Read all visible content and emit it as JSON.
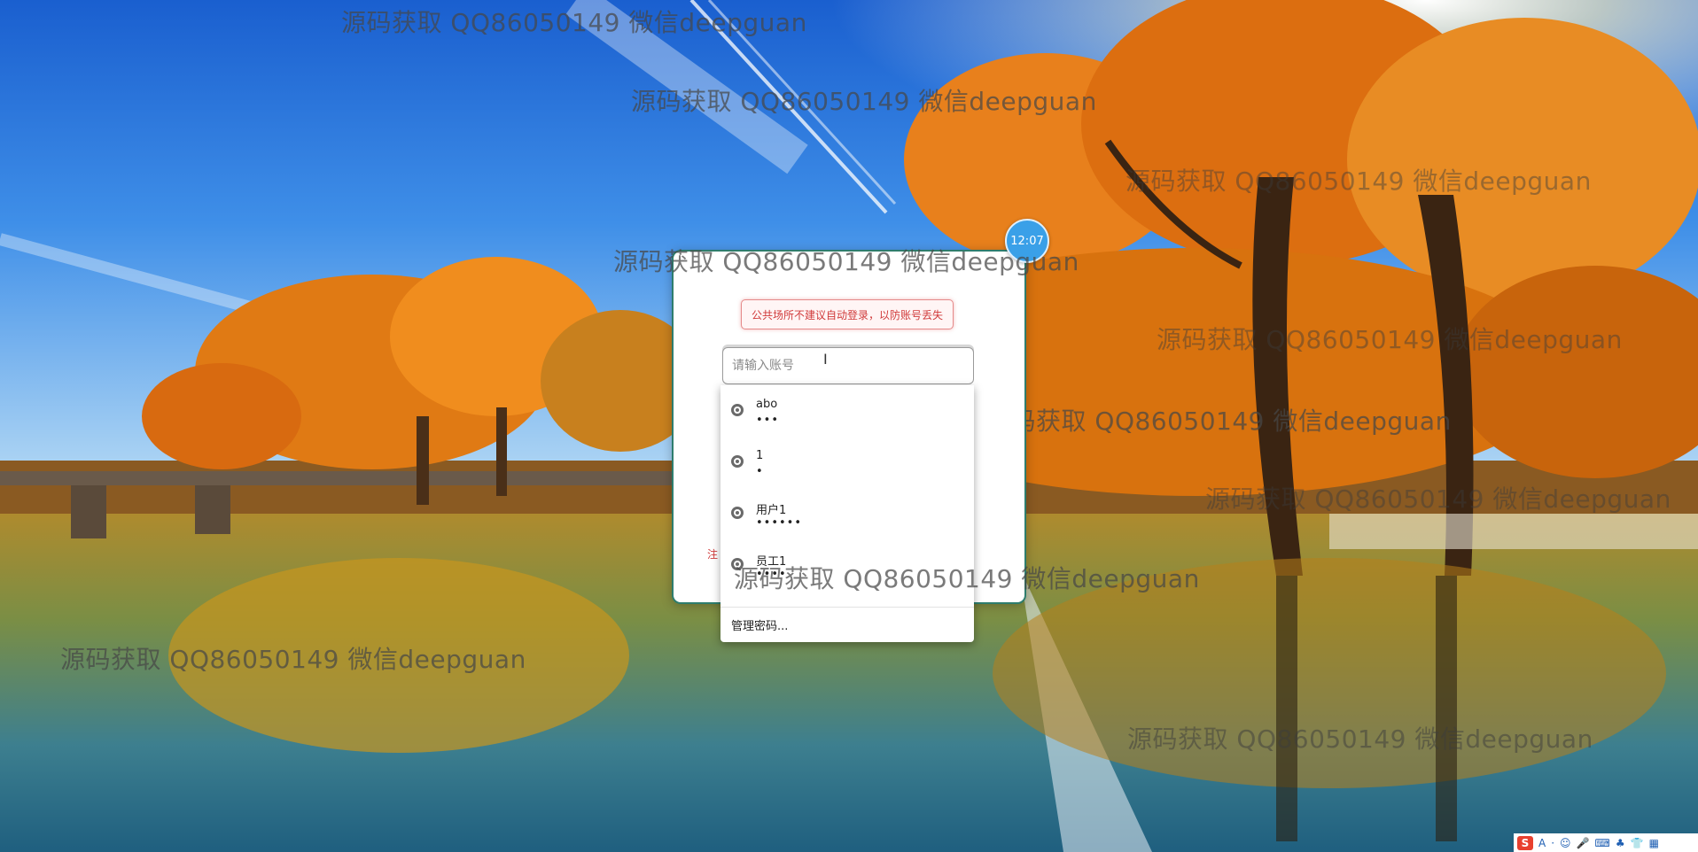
{
  "watermark_text": "源码获取 QQ86050149 微信deepguan",
  "clock": {
    "time": "12:07"
  },
  "login": {
    "notice": "公共场所不建议自动登录，以防账号丢失",
    "account_placeholder": "请输入账号",
    "register_hint": "注"
  },
  "autofill": {
    "items": [
      {
        "username": "abo",
        "password_mask": "•••"
      },
      {
        "username": "1",
        "password_mask": "•"
      },
      {
        "username": "用户1",
        "password_mask": "••••••"
      },
      {
        "username": "员工1",
        "password_mask": "••••"
      }
    ],
    "manage_label": "管理密码..."
  },
  "ime_toolbar": {
    "logo": "S",
    "items": [
      "A",
      "·",
      "☺",
      "🎤",
      "⌨",
      "♣",
      "👕",
      "▦"
    ]
  },
  "colors": {
    "card_border": "#2e7d6d",
    "clock_bg": "#3aa0e8",
    "notice_text": "#d03a3a",
    "ime_logo": "#e8402f"
  }
}
